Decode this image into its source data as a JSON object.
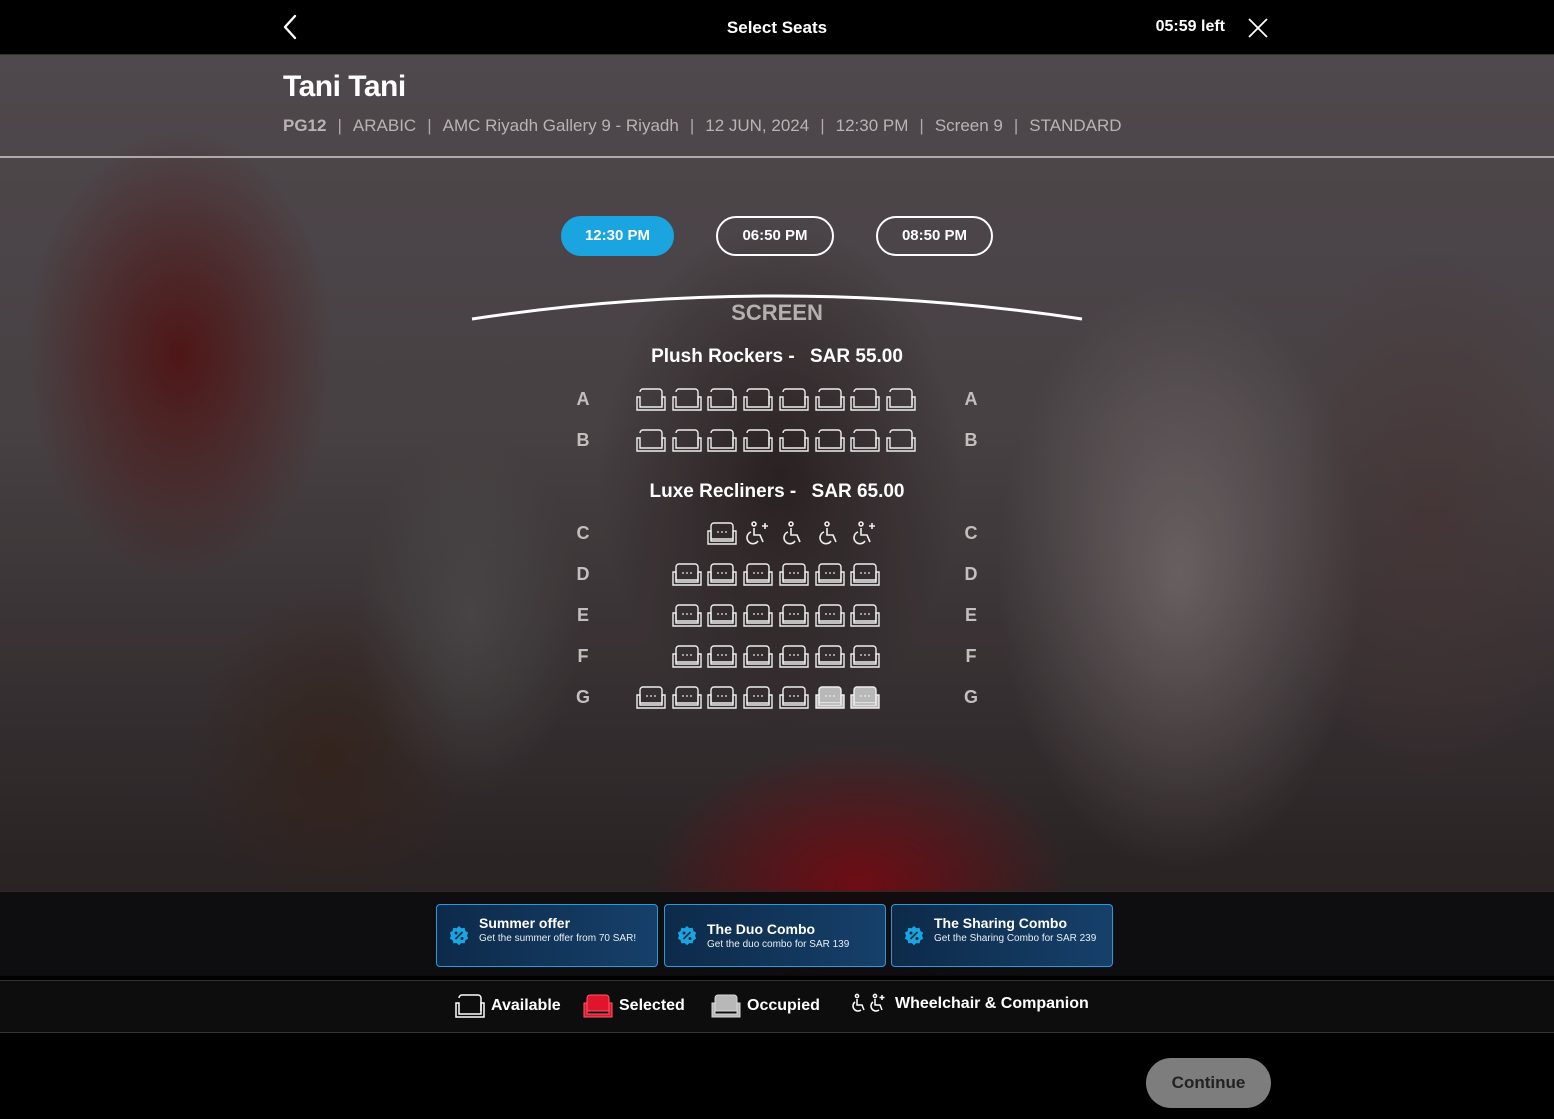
{
  "header": {
    "title": "Select Seats",
    "timer": "05:59 left",
    "back_icon": "chevron-left-icon",
    "close_icon": "close-icon"
  },
  "movie": {
    "title": "Tani Tani",
    "rating": "PG12",
    "language": "ARABIC",
    "cinema": "AMC Riyadh Gallery 9 - Riyadh",
    "date": "12 JUN, 2024",
    "time": "12:30 PM",
    "screen": "Screen 9",
    "format": "STANDARD"
  },
  "showtimes": [
    "12:30 PM",
    "06:50 PM",
    "08:50 PM"
  ],
  "selected_showtime": "12:30 PM",
  "screen_label": "SCREEN",
  "sections": [
    {
      "name": "Plush Rockers -",
      "currency": "SAR",
      "price": "55.00"
    },
    {
      "name": "Luxe Recliners -",
      "currency": "SAR",
      "price": "65.00"
    }
  ],
  "rows": [
    {
      "label": "A",
      "section": 0,
      "seats": [
        "available",
        "available",
        "available",
        "available",
        "available",
        "available",
        "available",
        "available"
      ]
    },
    {
      "label": "B",
      "section": 0,
      "seats": [
        "available",
        "available",
        "available",
        "available",
        "available",
        "available",
        "available",
        "available"
      ]
    },
    {
      "label": "C",
      "section": 1,
      "seats": [
        "available",
        "companion",
        "wheelchair",
        "wheelchair",
        "companion"
      ]
    },
    {
      "label": "D",
      "section": 1,
      "seats": [
        "available",
        "available",
        "available",
        "available",
        "available",
        "available"
      ]
    },
    {
      "label": "E",
      "section": 1,
      "seats": [
        "available",
        "available",
        "available",
        "available",
        "available",
        "available"
      ]
    },
    {
      "label": "F",
      "section": 1,
      "seats": [
        "available",
        "available",
        "available",
        "available",
        "available",
        "available"
      ]
    },
    {
      "label": "G",
      "section": 1,
      "seats": [
        "available",
        "available",
        "available",
        "available",
        "available",
        "occupied",
        "occupied"
      ]
    }
  ],
  "offers": [
    {
      "title": "Summer offer",
      "description": "Get the summer offer from 70 SAR!"
    },
    {
      "title": "The Duo Combo",
      "description": "Get the duo combo for SAR 139"
    },
    {
      "title": "The Sharing Combo",
      "description": "Get the Sharing Combo for SAR 239"
    }
  ],
  "legend": {
    "available": "Available",
    "selected": "Selected",
    "occupied": "Occupied",
    "wheelchair": "Wheelchair & Companion"
  },
  "colors": {
    "accent": "#1aa4e0",
    "selected": "#e0142c",
    "occupied": "#b8b8b8",
    "offer_border": "#2a9bd8"
  },
  "continue_label": "Continue"
}
